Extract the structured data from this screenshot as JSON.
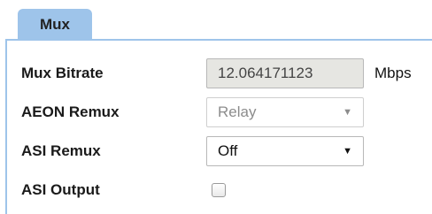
{
  "tab": {
    "label": "Mux"
  },
  "rows": {
    "mux_bitrate": {
      "label": "Mux Bitrate",
      "value": "12.064171123",
      "unit": "Mbps"
    },
    "aeon_remux": {
      "label": "AEON Remux",
      "value": "Relay",
      "disabled": true
    },
    "asi_remux": {
      "label": "ASI Remux",
      "value": "Off"
    },
    "asi_output": {
      "label": "ASI Output",
      "checked": false
    }
  },
  "icons": {
    "dropdown": "chevron-down-icon"
  }
}
